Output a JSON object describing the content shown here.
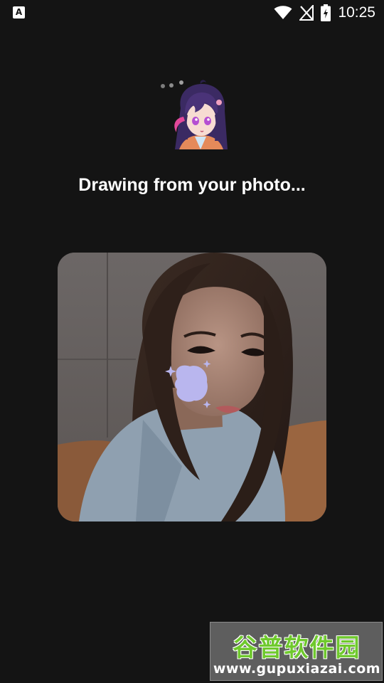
{
  "status_bar": {
    "left_icon_letter": "A",
    "left_icon": "notification-a-icon",
    "icons": [
      "wifi-icon",
      "no-signal-icon",
      "battery-charging-icon"
    ],
    "time": "10:25"
  },
  "loading": {
    "dots_icon": "loading-dots-icon",
    "avatar": "anime-girl-avatar",
    "message": "Drawing from your photo..."
  },
  "photo": {
    "description_icon": "user-photo",
    "overlay_icon": "drawing-brush-blob-icon",
    "overlay_color": "#b9b6ee"
  },
  "watermark": {
    "title": "谷普软件园",
    "url": "www.gupuxiazai.com",
    "title_color": "#6fc92d"
  }
}
